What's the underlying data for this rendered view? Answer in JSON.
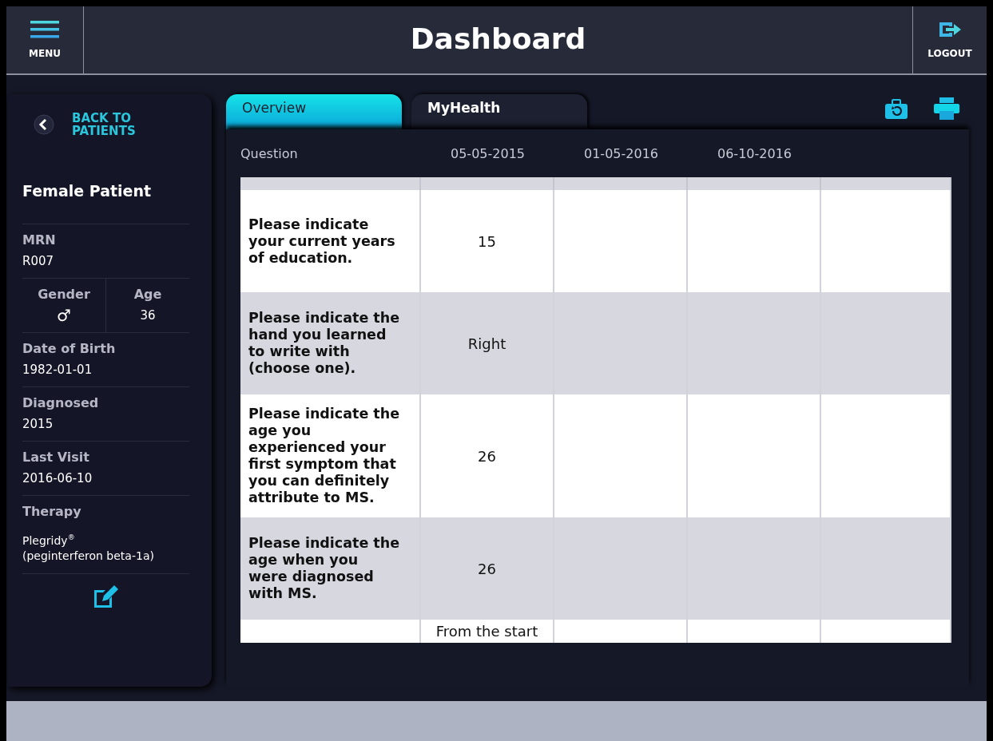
{
  "header": {
    "menu_label": "MENU",
    "title": "Dashboard",
    "logout_label": "LOGOUT"
  },
  "sidebar": {
    "back_label": "BACK TO PATIENTS",
    "patient_name": "Female Patient",
    "mrn_label": "MRN",
    "mrn": "R007",
    "gender_label": "Gender",
    "gender_symbol": "♂",
    "age_label": "Age",
    "age": "36",
    "fields": [
      {
        "label": "Date of Birth",
        "value": "1982-01-01"
      },
      {
        "label": "Diagnosed",
        "value": "2015"
      },
      {
        "label": "Last Visit",
        "value": "2016-06-10"
      }
    ],
    "therapy_label": "Therapy",
    "therapy_lines": [
      "Plegridy$^{®}$",
      "(peginterferon beta-1a)"
    ]
  },
  "tabs": [
    {
      "label": "Overview",
      "selected": true
    },
    {
      "label": "MyHealth",
      "selected": false
    }
  ],
  "table": {
    "columns": [
      "Question",
      "05-05-2015",
      "01-05-2016",
      "06-10-2016"
    ],
    "rows": [
      {
        "question": "Please indicate your current years of education.",
        "answers": [
          "15"
        ]
      },
      {
        "question": "Please indicate the hand you learned to write with (choose one).",
        "answers": [
          "Right"
        ]
      },
      {
        "question": "Please indicate the age you experienced your first symptom that you can definitely attribute to MS.",
        "answers": [
          "26"
        ]
      },
      {
        "question": "Please indicate the age when you were diagnosed with MS.",
        "answers": [
          "26"
        ]
      },
      {
        "question": "",
        "answers": [
          "From the start"
        ]
      }
    ]
  }
}
